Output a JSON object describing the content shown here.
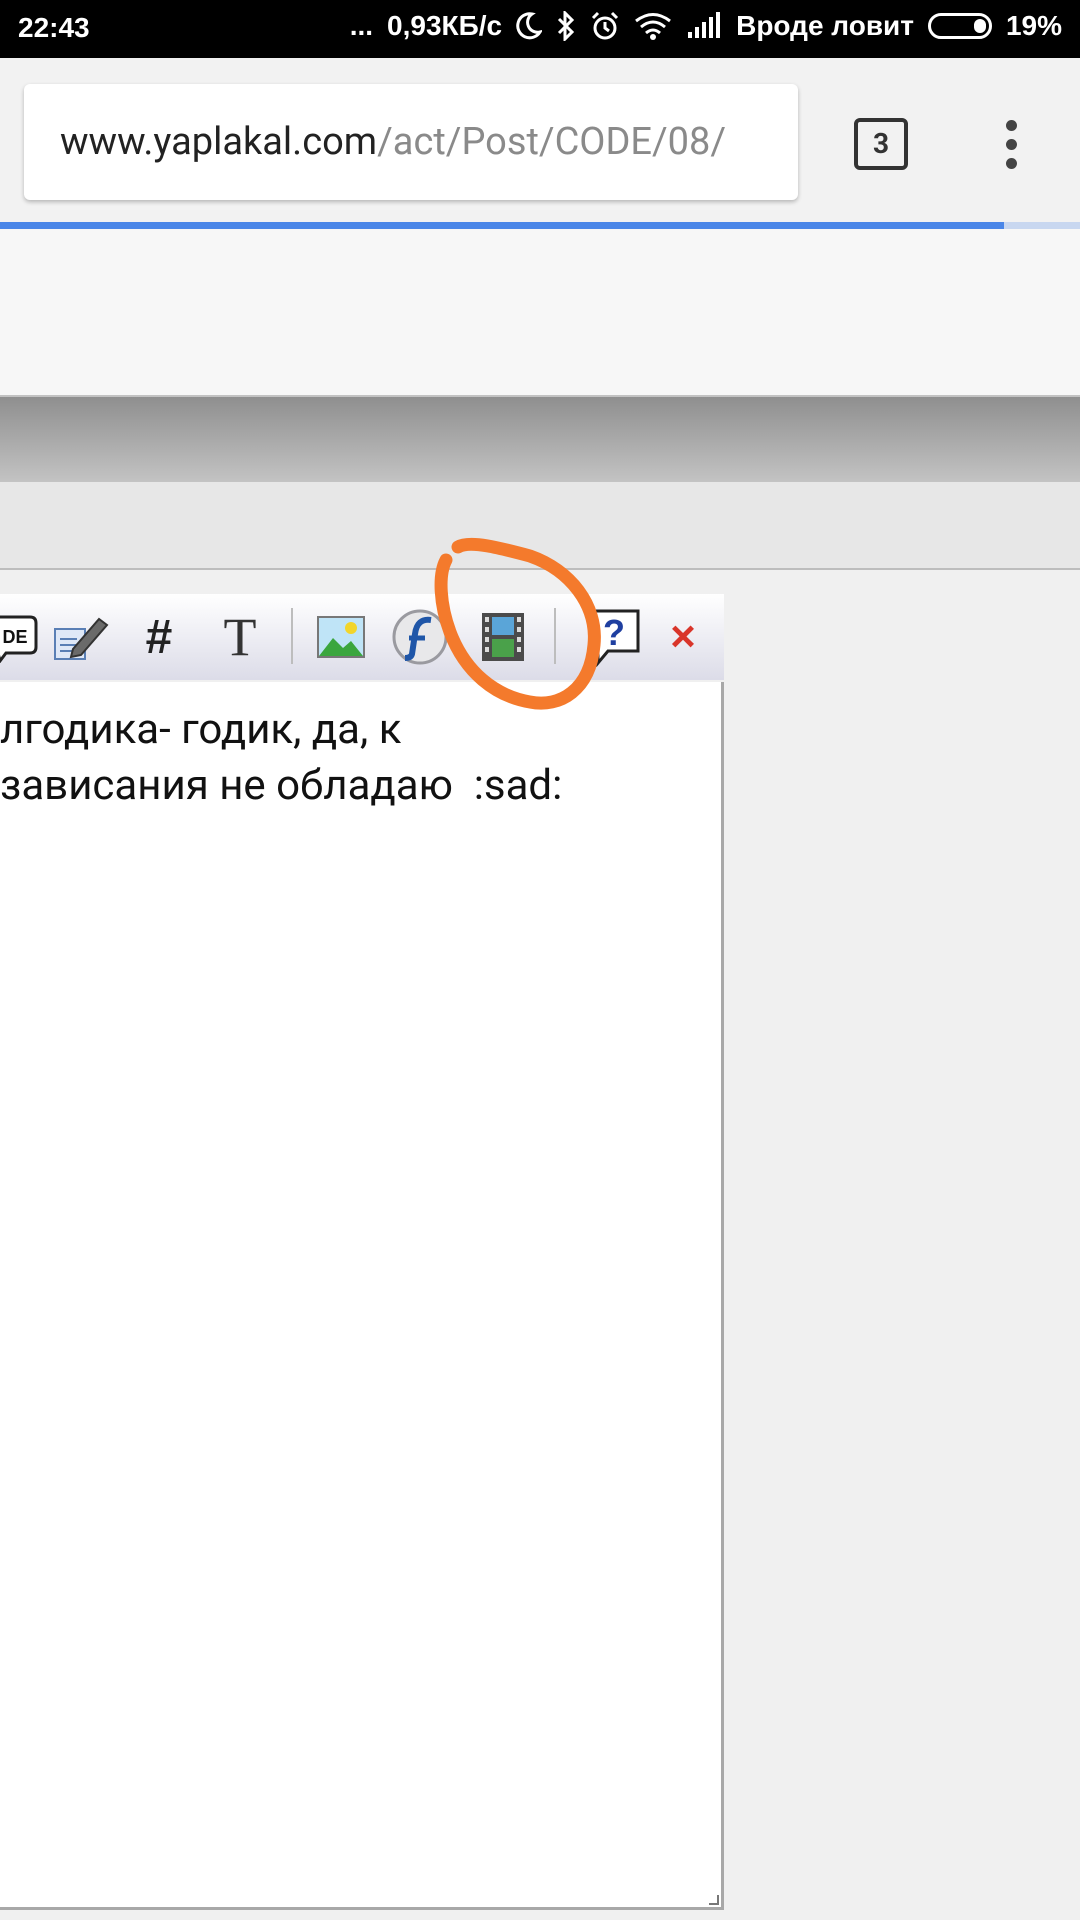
{
  "status_bar": {
    "time": "22:43",
    "dots": "...",
    "net_speed": "0,93КБ/с",
    "carrier": "Вроде ловит",
    "battery": "19%"
  },
  "browser": {
    "url_domain": "www.yaplakal.com",
    "url_path": "/act/Post/CODE/08/",
    "tab_count": "3",
    "load_progress": 0.93
  },
  "editor_toolbar": {
    "code_label": "DE",
    "hash_label": "#",
    "text_label": "T",
    "help_label": "?",
    "close_label": "×"
  },
  "editor": {
    "line1": "лгодика- годик, да, к",
    "line2": "зависания не обладаю  :sad:"
  },
  "colors": {
    "annotation": "#f47a2c",
    "progress": "#4a86e8"
  }
}
